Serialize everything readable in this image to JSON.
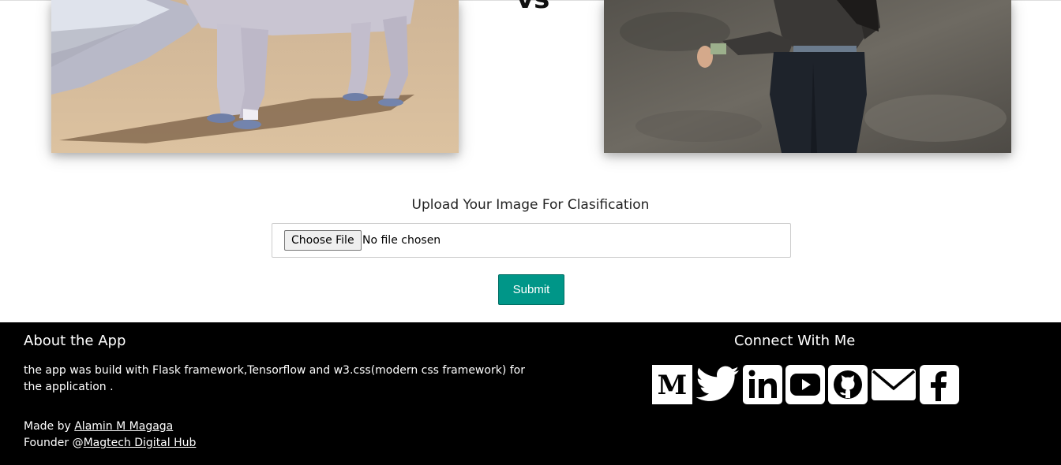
{
  "comparison": {
    "vs_label": "vs",
    "left_image_icon": "horse-photo",
    "right_image_icon": "human-photo"
  },
  "upload": {
    "label": "Upload Your Image For Clasification",
    "choose_button": "Choose File",
    "file_status": "No file chosen",
    "submit_label": "Submit",
    "accent_color": "#009688"
  },
  "footer": {
    "about_title": "About the App",
    "about_text": "the app was build with Flask framework,Tensorflow and w3.css(modern css framework) for the application .",
    "made_by_prefix": "Made by ",
    "author": "Alamin M Magaga",
    "founder_prefix": "Founder @",
    "company": "Magtech Digital Hub",
    "connect_title": "Connect With Me",
    "social_icons": [
      "medium-icon",
      "twitter-icon",
      "linkedin-icon",
      "youtube-icon",
      "github-icon",
      "email-icon",
      "facebook-icon"
    ]
  }
}
